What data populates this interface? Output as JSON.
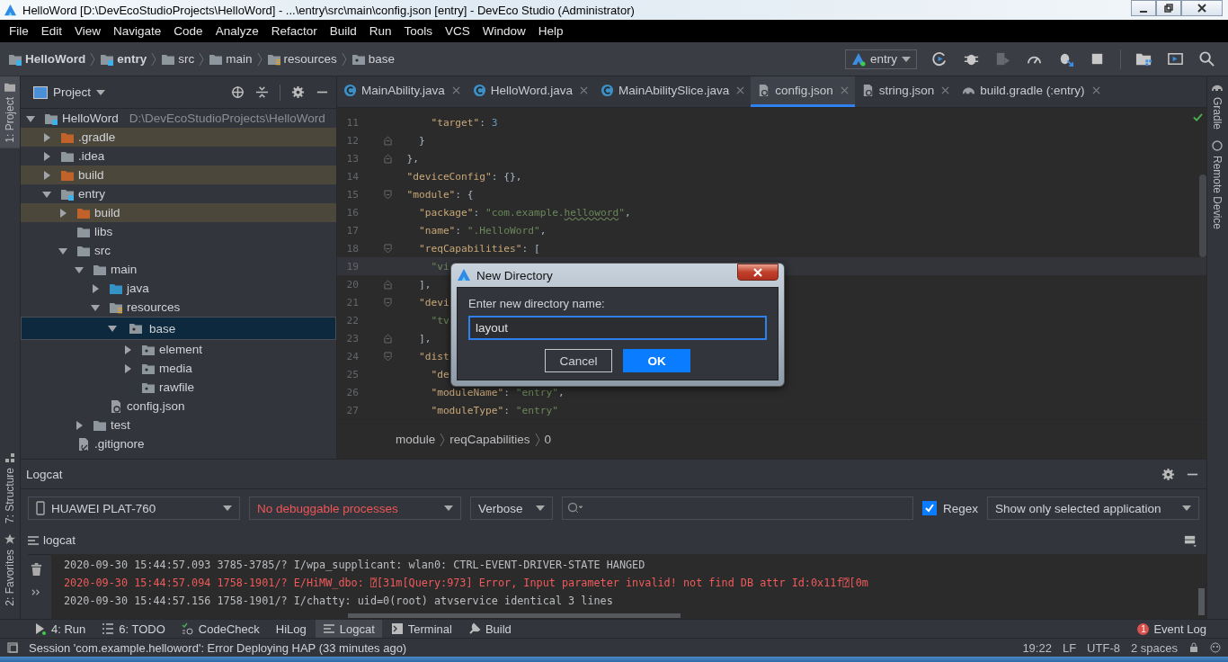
{
  "window": {
    "title": "HelloWord [D:\\DevEcoStudioProjects\\HelloWord] - ...\\entry\\src\\main\\config.json [entry] - DevEco Studio (Administrator)"
  },
  "menu": [
    "File",
    "Edit",
    "View",
    "Navigate",
    "Code",
    "Analyze",
    "Refactor",
    "Build",
    "Run",
    "Tools",
    "VCS",
    "Window",
    "Help"
  ],
  "breadcrumbs": [
    {
      "label": "HelloWord",
      "kind": "module"
    },
    {
      "label": "entry",
      "kind": "module"
    },
    {
      "label": "src",
      "kind": "folder"
    },
    {
      "label": "main",
      "kind": "folder"
    },
    {
      "label": "resources",
      "kind": "resources"
    },
    {
      "label": "base",
      "kind": "res"
    }
  ],
  "run_config": {
    "label": "entry"
  },
  "toolbar": [
    {
      "kind": "rerun",
      "disabled": false
    },
    {
      "kind": "debug",
      "disabled": false
    },
    {
      "kind": "attach",
      "disabled": true
    },
    {
      "kind": "profile",
      "disabled": false
    },
    {
      "kind": "attach-debug",
      "disabled": false
    },
    {
      "kind": "stop",
      "disabled": false
    },
    {
      "kind": "structure",
      "disabled": false
    },
    {
      "kind": "device",
      "disabled": false
    },
    {
      "kind": "search",
      "disabled": false
    }
  ],
  "left_strip": [
    {
      "label": "1: Project",
      "kind": "folder",
      "selected": true
    },
    {
      "label": "7: Structure",
      "kind": "structure",
      "selected": false
    },
    {
      "label": "2: Favorites",
      "kind": "star",
      "selected": false
    }
  ],
  "right_strip": [
    {
      "label": "Gradle",
      "kind": "gradle"
    },
    {
      "label": "Remote Device",
      "kind": "device"
    }
  ],
  "project_tree": {
    "title": "Project",
    "items": [
      {
        "label": "HelloWord",
        "path": "D:\\DevEcoStudioProjects\\HelloWord",
        "kind": "module",
        "expanded": true,
        "selected": false,
        "children": [
          {
            "label": ".gradle",
            "kind": "excluded",
            "expanded": false,
            "selected": false
          },
          {
            "label": ".idea",
            "kind": "folder",
            "expanded": false,
            "selected": false
          },
          {
            "label": "build",
            "kind": "excluded",
            "expanded": false,
            "selected": false
          },
          {
            "label": "entry",
            "kind": "module",
            "expanded": true,
            "selected": false,
            "children": [
              {
                "label": "build",
                "kind": "excluded",
                "expanded": false,
                "selected": false
              },
              {
                "label": "libs",
                "kind": "folder",
                "selected": false
              },
              {
                "label": "src",
                "kind": "folder",
                "expanded": true,
                "selected": false,
                "children": [
                  {
                    "label": "main",
                    "kind": "folder",
                    "expanded": true,
                    "selected": false,
                    "children": [
                      {
                        "label": "java",
                        "kind": "source",
                        "expanded": false,
                        "selected": false
                      },
                      {
                        "label": "resources",
                        "kind": "resources",
                        "expanded": true,
                        "selected": false,
                        "children": [
                          {
                            "label": "base",
                            "kind": "res",
                            "expanded": true,
                            "selected": true,
                            "children": [
                              {
                                "label": "element",
                                "kind": "res",
                                "expanded": false,
                                "selected": false
                              },
                              {
                                "label": "media",
                                "kind": "res",
                                "expanded": false,
                                "selected": false
                              },
                              {
                                "label": "rawfile",
                                "kind": "res",
                                "selected": false
                              }
                            ]
                          }
                        ]
                      },
                      {
                        "label": "config.json",
                        "kind": "json",
                        "selected": false
                      }
                    ]
                  },
                  {
                    "label": "test",
                    "kind": "folder",
                    "expanded": false,
                    "selected": false
                  }
                ]
              },
              {
                "label": ".gitignore",
                "kind": "git",
                "selected": false
              }
            ]
          }
        ]
      }
    ]
  },
  "tabs": [
    {
      "label": "MainAbility.java",
      "kind": "java",
      "selected": false
    },
    {
      "label": "HelloWord.java",
      "kind": "java",
      "selected": false
    },
    {
      "label": "MainAbilitySlice.java",
      "kind": "java",
      "selected": false
    },
    {
      "label": "config.json",
      "kind": "json",
      "selected": true
    },
    {
      "label": "string.json",
      "kind": "json",
      "selected": false
    },
    {
      "label": "build.gradle (:entry)",
      "kind": "gradle",
      "selected": false
    }
  ],
  "code_lines": [
    {
      "number": "11",
      "current": false,
      "fold_start": false,
      "fold_end": false,
      "parts": [
        {
          "kind": "key",
          "text": "      \"target\""
        },
        {
          "kind": "punct",
          "text": ": "
        },
        {
          "kind": "number",
          "text": "3"
        }
      ]
    },
    {
      "number": "12",
      "current": false,
      "fold_start": false,
      "fold_end": true,
      "parts": [
        {
          "kind": "punct",
          "text": "    }"
        }
      ]
    },
    {
      "number": "13",
      "current": false,
      "fold_start": false,
      "fold_end": true,
      "parts": [
        {
          "kind": "punct",
          "text": "  },"
        }
      ]
    },
    {
      "number": "14",
      "current": false,
      "fold_start": false,
      "fold_end": false,
      "parts": [
        {
          "kind": "key",
          "text": "  \"deviceConfig\""
        },
        {
          "kind": "punct",
          "text": ": {},"
        }
      ]
    },
    {
      "number": "15",
      "current": false,
      "fold_start": true,
      "fold_end": false,
      "parts": [
        {
          "kind": "key",
          "text": "  \"module\""
        },
        {
          "kind": "punct",
          "text": ": {"
        }
      ]
    },
    {
      "number": "16",
      "current": false,
      "fold_start": false,
      "fold_end": false,
      "parts": [
        {
          "kind": "key",
          "text": "    \"package\""
        },
        {
          "kind": "punct",
          "text": ": "
        },
        {
          "kind": "string",
          "text": "\"com.example."
        },
        {
          "kind": "typo",
          "text": "helloword"
        },
        {
          "kind": "string",
          "text": "\""
        },
        {
          "kind": "punct",
          "text": ","
        }
      ]
    },
    {
      "number": "17",
      "current": false,
      "fold_start": false,
      "fold_end": false,
      "parts": [
        {
          "kind": "key",
          "text": "    \"name\""
        },
        {
          "kind": "punct",
          "text": ": "
        },
        {
          "kind": "string",
          "text": "\".HelloWord\""
        },
        {
          "kind": "punct",
          "text": ","
        }
      ]
    },
    {
      "number": "18",
      "current": false,
      "fold_start": true,
      "fold_end": false,
      "parts": [
        {
          "kind": "key",
          "text": "    \"reqCapabilities\""
        },
        {
          "kind": "punct",
          "text": ": ["
        }
      ]
    },
    {
      "number": "19",
      "current": true,
      "fold_start": false,
      "fold_end": false,
      "parts": [
        {
          "kind": "string",
          "text": "      \"vi"
        }
      ]
    },
    {
      "number": "20",
      "current": false,
      "fold_start": false,
      "fold_end": true,
      "parts": [
        {
          "kind": "punct",
          "text": "    ],"
        }
      ]
    },
    {
      "number": "21",
      "current": false,
      "fold_start": true,
      "fold_end": false,
      "parts": [
        {
          "kind": "key",
          "text": "    \"devi"
        }
      ]
    },
    {
      "number": "22",
      "current": false,
      "fold_start": false,
      "fold_end": false,
      "parts": [
        {
          "kind": "string",
          "text": "      \"tv"
        }
      ]
    },
    {
      "number": "23",
      "current": false,
      "fold_start": false,
      "fold_end": true,
      "parts": [
        {
          "kind": "punct",
          "text": "    ],"
        }
      ]
    },
    {
      "number": "24",
      "current": false,
      "fold_start": true,
      "fold_end": false,
      "parts": [
        {
          "kind": "key",
          "text": "    \"dist"
        }
      ]
    },
    {
      "number": "25",
      "current": false,
      "fold_start": false,
      "fold_end": false,
      "parts": [
        {
          "kind": "key",
          "text": "      \"de"
        }
      ]
    },
    {
      "number": "26",
      "current": false,
      "fold_start": false,
      "fold_end": false,
      "parts": [
        {
          "kind": "key",
          "text": "      \"moduleName\""
        },
        {
          "kind": "punct",
          "text": ": "
        },
        {
          "kind": "string",
          "text": "\"entry\""
        },
        {
          "kind": "punct",
          "text": ","
        }
      ]
    },
    {
      "number": "27",
      "current": false,
      "fold_start": false,
      "fold_end": false,
      "parts": [
        {
          "kind": "key",
          "text": "      \"moduleType\""
        },
        {
          "kind": "punct",
          "text": ": "
        },
        {
          "kind": "string",
          "text": "\"entry\""
        }
      ]
    }
  ],
  "editor_breadcrumbs": [
    "module",
    "reqCapabilities",
    "0"
  ],
  "dialog": {
    "title": "New Directory",
    "label": "Enter new directory name:",
    "value": "layout",
    "buttons": [
      {
        "label": "Cancel",
        "kind": "secondary"
      },
      {
        "label": "OK",
        "kind": "primary"
      }
    ]
  },
  "logcat": {
    "title": "Logcat",
    "device": "HUAWEI PLAT-760",
    "process": "No debuggable processes",
    "level": "Verbose",
    "regex": {
      "label": "Regex",
      "checked": true
    },
    "filter": "Show only selected application",
    "tab": "logcat",
    "lines": [
      {
        "error": false,
        "text": "2020-09-30 15:44:57.093 3785-3785/? I/wpa_supplicant: wlan0: CTRL-EVENT-DRIVER-STATE HANGED"
      },
      {
        "error": true,
        "text": "2020-09-30 15:44:57.094 1758-1901/? E/HiMW_dbo: ⍰[31m[Query:973] Error, Input parameter invalid! not find DB attr Id:0x11f⍰[0m"
      },
      {
        "error": false,
        "text": "2020-09-30 15:44:57.156 1758-1901/? I/chatty: uid=0(root) atvservice identical 3 lines"
      }
    ]
  },
  "tool_windows": [
    {
      "label": "4: Run",
      "kind": "run",
      "selected": false
    },
    {
      "label": "6: TODO",
      "kind": "todo",
      "selected": false
    },
    {
      "label": "CodeCheck",
      "kind": "check",
      "selected": false
    },
    {
      "label": "HiLog",
      "kind": "none",
      "selected": false
    },
    {
      "label": "Logcat",
      "kind": "log",
      "selected": true
    },
    {
      "label": "Terminal",
      "kind": "terminal",
      "selected": false
    },
    {
      "label": "Build",
      "kind": "build",
      "selected": false
    }
  ],
  "event_log": {
    "label": "Event Log",
    "count": "1"
  },
  "status_bar": {
    "message": "Session 'com.example.helloword': Error Deploying HAP (33 minutes ago)",
    "items": [
      "19:22",
      "LF",
      "UTF-8",
      "2 spaces"
    ]
  }
}
